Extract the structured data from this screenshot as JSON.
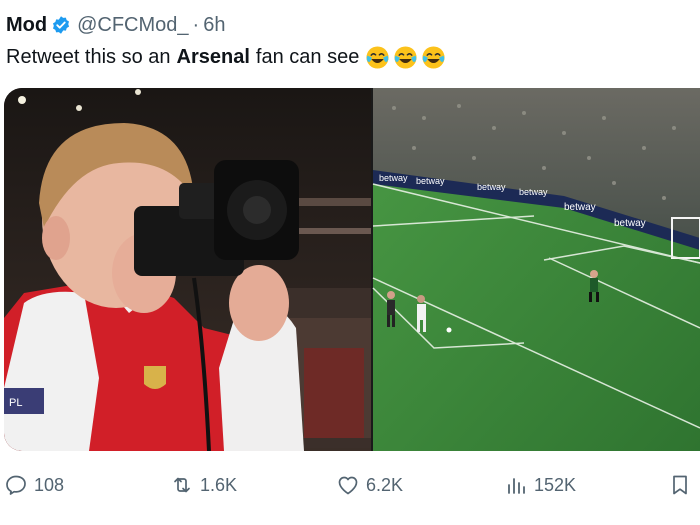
{
  "tweet": {
    "author_name": "Mod",
    "handle": "@CFCMod_",
    "separator": "·",
    "time": "6h",
    "text_before": "Retweet this so an",
    "text_bold": "Arsenal",
    "text_after": "fan can see",
    "emojis": [
      "face-with-tears-of-joy-emoji",
      "face-with-tears-of-joy-emoji",
      "face-with-tears-of-joy-emoji"
    ],
    "verified_color": "#1d9bf0"
  },
  "media": {
    "left_image_text": {
      "sponsor_patch": "PL"
    },
    "right_image_text": {
      "boards": [
        "betway",
        "betway",
        "betway",
        "betway",
        "betway",
        "betway"
      ]
    }
  },
  "actions": {
    "replies": "108",
    "retweets": "1.6K",
    "likes": "6.2K",
    "views": "152K"
  },
  "colors": {
    "text_primary": "#0f1419",
    "text_secondary": "#536471",
    "pitch_green": "#3f8a3c"
  }
}
